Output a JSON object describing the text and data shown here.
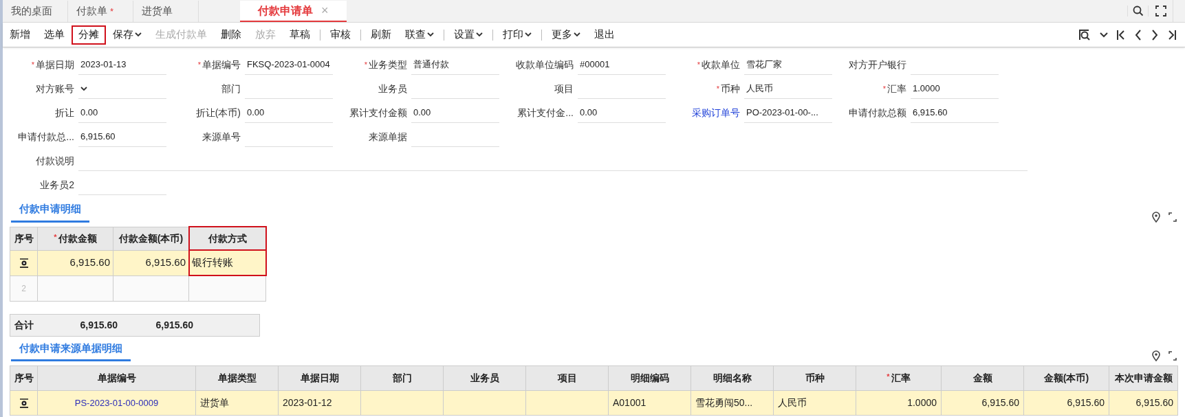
{
  "tabs": [
    {
      "label": "我的桌面",
      "selected": false
    },
    {
      "label": "付款单",
      "selected": false,
      "modified_mark": "*"
    },
    {
      "label": "进货单",
      "selected": false
    },
    {
      "label": "付款申请单",
      "selected": true,
      "close_label": "×"
    }
  ],
  "toolbar": [
    {
      "label": "新增",
      "disabled": false,
      "dropdown": false,
      "separator_after": false,
      "highlighted": false
    },
    {
      "label": "选单",
      "disabled": false,
      "dropdown": false,
      "separator_after": false,
      "highlighted": false
    },
    {
      "label": "分摊",
      "disabled": false,
      "dropdown": false,
      "separator_after": false,
      "highlighted": true
    },
    {
      "label": "保存",
      "disabled": false,
      "dropdown": true,
      "separator_after": false,
      "highlighted": false
    },
    {
      "label": "生成付款单",
      "disabled": true,
      "dropdown": false,
      "separator_after": false,
      "highlighted": false
    },
    {
      "label": "删除",
      "disabled": false,
      "dropdown": false,
      "separator_after": false,
      "highlighted": false
    },
    {
      "label": "放弃",
      "disabled": true,
      "dropdown": false,
      "separator_after": false,
      "highlighted": false
    },
    {
      "label": "草稿",
      "disabled": false,
      "dropdown": false,
      "separator_after": true,
      "highlighted": false
    },
    {
      "label": "审核",
      "disabled": false,
      "dropdown": false,
      "separator_after": true,
      "highlighted": false
    },
    {
      "label": "刷新",
      "disabled": false,
      "dropdown": false,
      "separator_after": false,
      "highlighted": false
    },
    {
      "label": "联查",
      "disabled": false,
      "dropdown": true,
      "separator_after": true,
      "highlighted": false
    },
    {
      "label": "设置",
      "disabled": false,
      "dropdown": true,
      "separator_after": true,
      "highlighted": false
    },
    {
      "label": "打印",
      "disabled": false,
      "dropdown": true,
      "separator_after": true,
      "highlighted": false
    },
    {
      "label": "更多",
      "disabled": false,
      "dropdown": true,
      "separator_after": false,
      "highlighted": false
    },
    {
      "label": "退出",
      "disabled": false,
      "dropdown": false,
      "separator_after": false,
      "highlighted": false
    }
  ],
  "form_rows": [
    [
      {
        "required_mark": "*",
        "label": "单据日期",
        "value": "2023-01-13"
      },
      {
        "required_mark": "*",
        "label": "单据编号",
        "value": "FKSQ-2023-01-0004"
      },
      {
        "required_mark": "*",
        "label": "业务类型",
        "value": "普通付款"
      },
      {
        "label": "收款单位编码",
        "value": "#00001"
      },
      {
        "required_mark": "*",
        "label": "收款单位",
        "value": "雪花厂家"
      },
      {
        "label": "对方开户银行"
      }
    ],
    [
      {
        "label": "对方账号",
        "kind": "select"
      },
      {
        "label": "部门"
      },
      {
        "label": "业务员"
      },
      {
        "label": "项目"
      },
      {
        "required_mark": "*",
        "label": "币种",
        "value": "人民币"
      },
      {
        "required_mark": "*",
        "label": "汇率",
        "value": "1.0000"
      }
    ],
    [
      {
        "label": "折让",
        "value": "0.00"
      },
      {
        "label": "折让(本币)",
        "value": "0.00"
      },
      {
        "label": "累计支付金额",
        "value": "0.00"
      },
      {
        "label": "累计支付金...",
        "value": "0.00"
      },
      {
        "label": "采购订单号",
        "value": "PO-2023-01-00-...",
        "kind": "link"
      },
      {
        "label": "申请付款总额",
        "value": "6,915.60"
      }
    ],
    [
      {
        "label": "申请付款总...",
        "value": "6,915.60"
      },
      {
        "label": "来源单号"
      },
      {
        "label": "来源单据"
      }
    ],
    [
      {
        "label": "付款说明",
        "kind": "wide"
      }
    ],
    [
      {
        "label": "业务员2"
      }
    ]
  ],
  "detail": {
    "title": "付款申请明细",
    "columns": [
      {
        "label": "序号",
        "highlighted": false
      },
      {
        "required_mark": "*",
        "label": "付款金额",
        "highlighted": false
      },
      {
        "label": "付款金额(本币)",
        "highlighted": false
      },
      {
        "label": "付款方式",
        "highlighted": true
      }
    ],
    "rows": [
      {
        "selected": true,
        "cells": [
          "",
          "6,915.60",
          "6,915.60",
          "银行转账"
        ]
      },
      {
        "selected": false,
        "cells": [
          "2",
          "",
          "",
          ""
        ]
      }
    ],
    "total": {
      "label": "合计",
      "values": [
        "6,915.60",
        "6,915.60"
      ]
    }
  },
  "source": {
    "title": "付款申请来源单据明细",
    "columns": [
      {
        "label": "序号"
      },
      {
        "label": "单据编号"
      },
      {
        "label": "单据类型"
      },
      {
        "label": "单据日期"
      },
      {
        "label": "部门"
      },
      {
        "label": "业务员"
      },
      {
        "label": "项目"
      },
      {
        "label": "明细编码"
      },
      {
        "label": "明细名称"
      },
      {
        "label": "币种"
      },
      {
        "required_mark": "*",
        "label": "汇率"
      },
      {
        "label": "金额"
      },
      {
        "label": "金额(本币)"
      },
      {
        "label": "本次申请金额"
      }
    ],
    "rows": [
      {
        "selected": true,
        "cells": [
          "",
          "PS-2023-01-00-0009",
          "进货单",
          "2023-01-12",
          "",
          "",
          "",
          "A01001",
          "雪花勇闯50...",
          "人民币",
          "1.0000",
          "6,915.60",
          "6,915.60",
          "6,915.60"
        ]
      }
    ]
  }
}
